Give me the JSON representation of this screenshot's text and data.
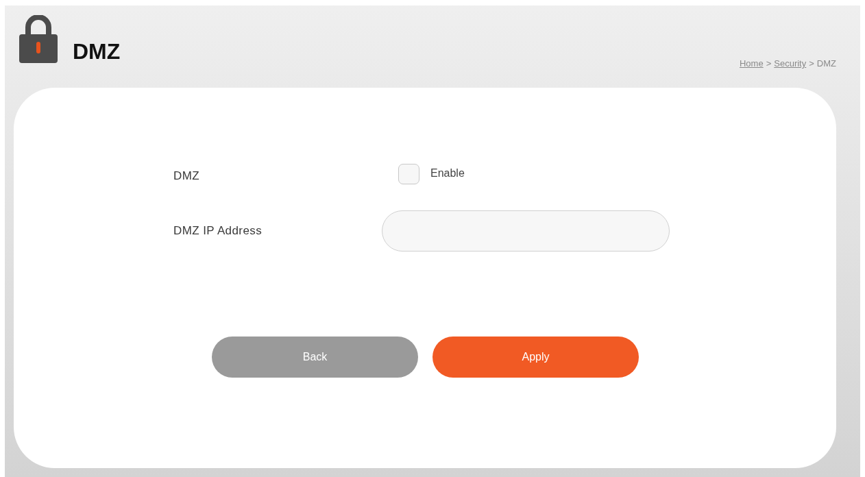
{
  "header": {
    "title": "DMZ",
    "breadcrumb": [
      {
        "kind": "link",
        "label": "Home"
      },
      {
        "kind": "separator",
        "label": ">"
      },
      {
        "kind": "link",
        "label": "Security"
      },
      {
        "kind": "separator",
        "label": ">"
      },
      {
        "kind": "current",
        "label": "DMZ"
      }
    ]
  },
  "form": {
    "fields": [
      {
        "kind": "checkbox",
        "label": "DMZ",
        "option": "Enable",
        "checked": false
      },
      {
        "kind": "text",
        "label": "DMZ IP Address"
      }
    ]
  },
  "buttons": [
    {
      "kind": "secondary",
      "label": "Back"
    },
    {
      "kind": "primary",
      "label": "Apply"
    }
  ]
}
